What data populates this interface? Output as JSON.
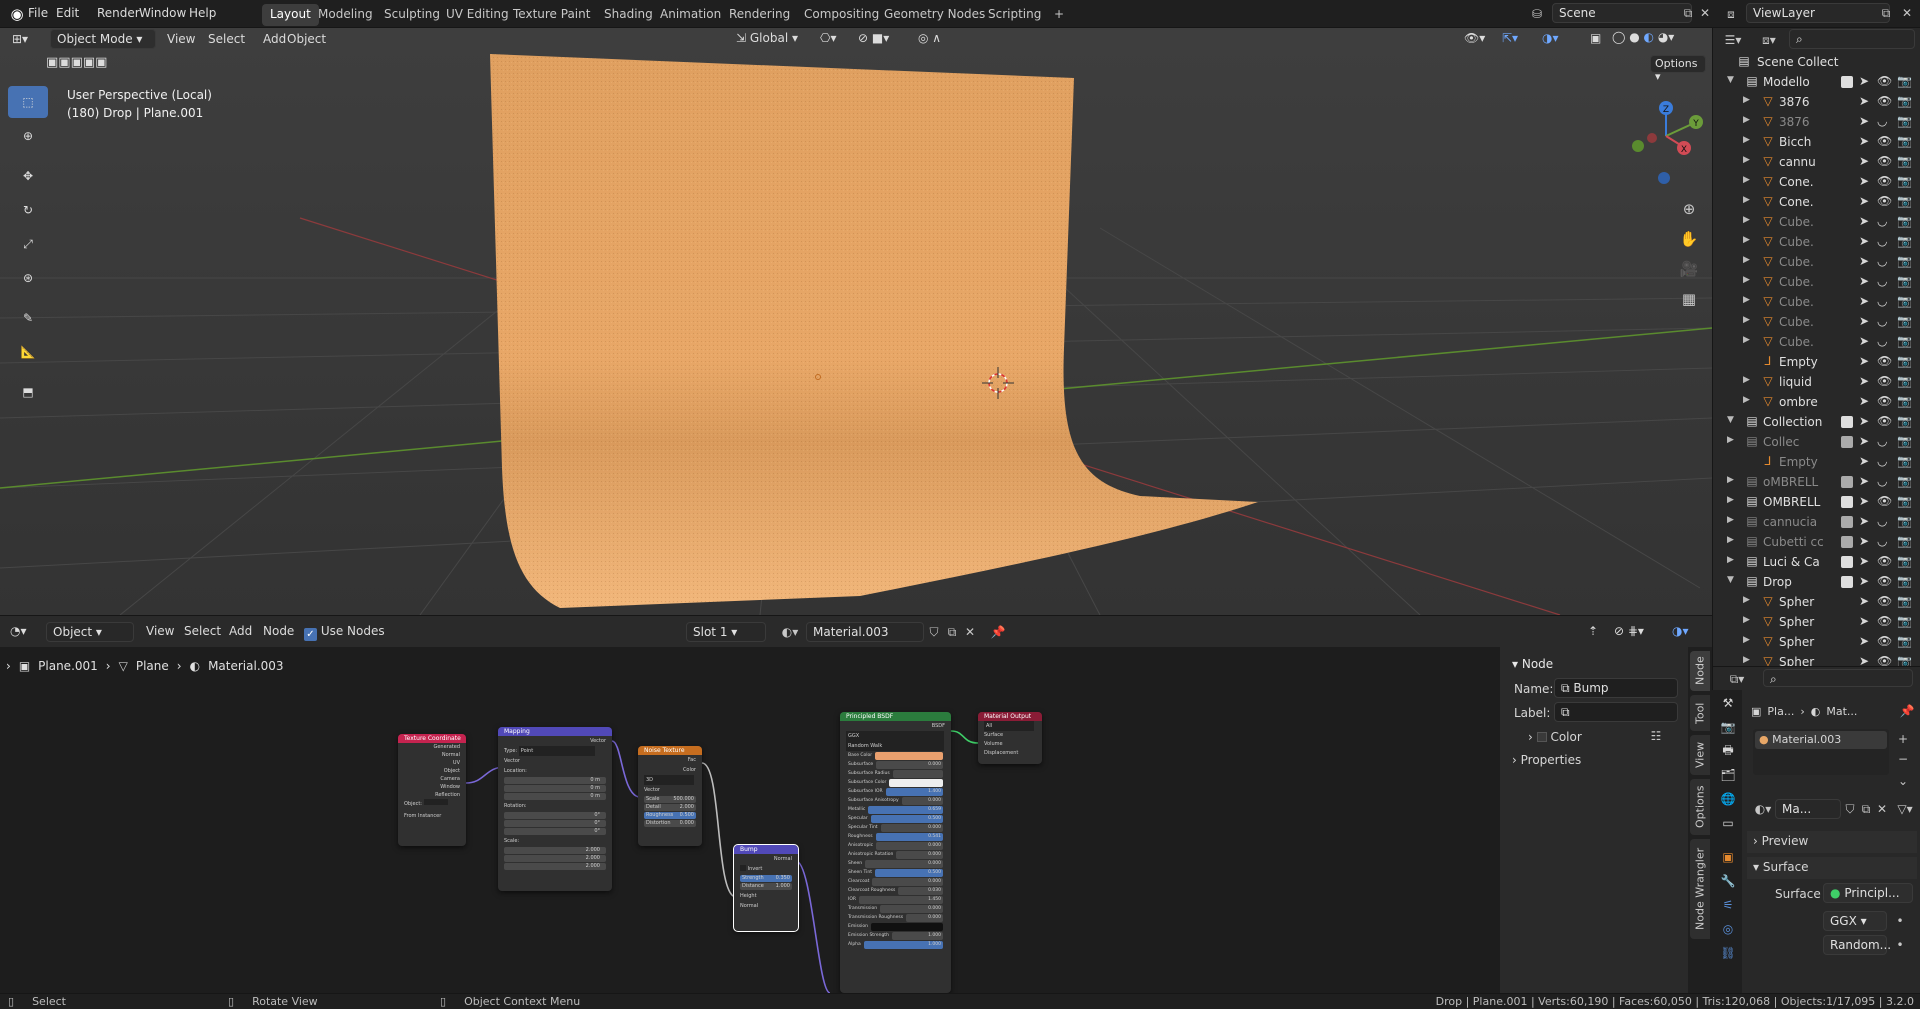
{
  "topbar": {
    "menus": [
      "File",
      "Edit",
      "Render",
      "Window",
      "Help"
    ],
    "workspaces": [
      "Layout",
      "Modeling",
      "Sculpting",
      "UV Editing",
      "Texture Paint",
      "Shading",
      "Animation",
      "Rendering",
      "Compositing",
      "Geometry Nodes",
      "Scripting"
    ],
    "active_workspace": "Layout",
    "add_tab": "+",
    "scene": "Scene",
    "view_layer": "ViewLayer"
  },
  "viewport": {
    "mode": "Object Mode",
    "menus": [
      "View",
      "Select",
      "Add",
      "Object"
    ],
    "orientation": "Global",
    "options": "Options",
    "info_line1": "User Perspective (Local)",
    "info_line2": "(180) Drop | Plane.001",
    "gizmo": {
      "x": "X",
      "y": "Y",
      "z": "Z"
    },
    "colors": {
      "bg": "#3a3a3a",
      "backdrop": "#e7a466",
      "x_axis": "#c0474c",
      "y_axis": "#5a8b2e"
    }
  },
  "tools": [
    "select-box",
    "cursor",
    "move",
    "rotate",
    "scale",
    "transform",
    "annotate",
    "measure",
    "add-cube"
  ],
  "outliner": {
    "title": "Scene Collect",
    "rows": [
      {
        "label": "Modello",
        "type": "collection",
        "depth": 0,
        "expanded": true,
        "checked": true,
        "dim": false
      },
      {
        "label": "3876",
        "type": "mesh",
        "depth": 1,
        "dim": false
      },
      {
        "label": "3876",
        "type": "mesh",
        "depth": 1,
        "dim": true
      },
      {
        "label": "Bicch",
        "type": "mesh",
        "depth": 1,
        "dim": false
      },
      {
        "label": "cannu",
        "type": "mesh",
        "depth": 1,
        "dim": false
      },
      {
        "label": "Cone.",
        "type": "mesh",
        "depth": 1,
        "dim": false
      },
      {
        "label": "Cone.",
        "type": "mesh",
        "depth": 1,
        "dim": false
      },
      {
        "label": "Cube.",
        "type": "mesh",
        "depth": 1,
        "dim": true
      },
      {
        "label": "Cube.",
        "type": "mesh",
        "depth": 1,
        "dim": true
      },
      {
        "label": "Cube.",
        "type": "mesh",
        "depth": 1,
        "dim": true
      },
      {
        "label": "Cube.",
        "type": "mesh",
        "depth": 1,
        "dim": true
      },
      {
        "label": "Cube.",
        "type": "mesh",
        "depth": 1,
        "dim": true
      },
      {
        "label": "Cube.",
        "type": "mesh",
        "depth": 1,
        "dim": true
      },
      {
        "label": "Cube.",
        "type": "mesh",
        "depth": 1,
        "dim": true
      },
      {
        "label": "Empty",
        "type": "empty",
        "depth": 1,
        "dim": false
      },
      {
        "label": "liquid",
        "type": "mesh",
        "depth": 1,
        "dim": false
      },
      {
        "label": "ombre",
        "type": "mesh",
        "depth": 1,
        "dim": false
      },
      {
        "label": "Collection",
        "type": "collection",
        "depth": 0,
        "expanded": true,
        "checked": true,
        "dim": false
      },
      {
        "label": "Collec",
        "type": "collection",
        "depth": 1,
        "checked": true,
        "dim": true
      },
      {
        "label": "Empty",
        "type": "empty",
        "depth": 1,
        "dim": true
      },
      {
        "label": "oMBRELL",
        "type": "collection",
        "depth": 0,
        "checked": true,
        "dim": true
      },
      {
        "label": "OMBRELL",
        "type": "collection",
        "depth": 0,
        "checked": true,
        "dim": false
      },
      {
        "label": "cannucia",
        "type": "collection",
        "depth": 0,
        "checked": true,
        "dim": true
      },
      {
        "label": "Cubetti cc",
        "type": "collection",
        "depth": 0,
        "checked": true,
        "dim": true
      },
      {
        "label": "Luci & Ca",
        "type": "collection",
        "depth": 0,
        "checked": true,
        "dim": false
      },
      {
        "label": "Drop",
        "type": "collection",
        "depth": 0,
        "expanded": true,
        "checked": true,
        "dim": false
      },
      {
        "label": "Spher",
        "type": "mesh",
        "depth": 1,
        "dim": false
      },
      {
        "label": "Spher",
        "type": "mesh",
        "depth": 1,
        "dim": false
      },
      {
        "label": "Spher",
        "type": "mesh",
        "depth": 1,
        "dim": false
      },
      {
        "label": "Spher",
        "type": "mesh",
        "depth": 1,
        "dim": false
      }
    ]
  },
  "node_editor": {
    "editor_type": "Object",
    "menus": [
      "View",
      "Select",
      "Add",
      "Node"
    ],
    "use_nodes_label": "Use Nodes",
    "slot": "Slot 1",
    "material": "Material.003",
    "breadcrumb": [
      "Plane.001",
      "Plane",
      "Material.003"
    ],
    "nodes": {
      "texcoord": {
        "title": "Texture Coordinate",
        "outputs": [
          "Generated",
          "Normal",
          "UV",
          "Object",
          "Camera",
          "Window",
          "Reflection"
        ],
        "object_label": "Object",
        "instancer": "From Instancer"
      },
      "mapping": {
        "title": "Mapping",
        "out": "Vector",
        "type_label": "Type:",
        "type": "Point",
        "vector": "Vector",
        "location": "Location:",
        "rotation": "Rotation:",
        "scale": "Scale:",
        "loc": [
          "0 m",
          "0 m",
          "0 m"
        ],
        "rot": [
          "0°",
          "0°",
          "0°"
        ],
        "scl": [
          "2.000",
          "2.000",
          "2.000"
        ]
      },
      "noise": {
        "title": "Noise Texture",
        "outputs": [
          "Fac",
          "Color"
        ],
        "dim": "3D",
        "vector": "Vector",
        "fields": [
          [
            "Scale",
            "500.000"
          ],
          [
            "Detail",
            "2.000"
          ],
          [
            "Roughness",
            "0.500"
          ],
          [
            "Distortion",
            "0.000"
          ]
        ]
      },
      "bump": {
        "title": "Bump",
        "out": "Normal",
        "invert": "Invert",
        "fields": [
          [
            "Strength",
            "0.350"
          ],
          [
            "Distance",
            "1.000"
          ]
        ],
        "inputs": [
          "Height",
          "Normal"
        ]
      },
      "bsdf": {
        "title": "Principled BSDF",
        "out": "BSDF",
        "dist": "GGX",
        "sss": "Random Walk",
        "rows": [
          [
            "Base Color",
            ""
          ],
          [
            "Subsurface",
            "0.000"
          ],
          [
            "Subsurface Radius",
            ""
          ],
          [
            "Subsurface Color",
            ""
          ],
          [
            "Subsurface IOR",
            "1.400"
          ],
          [
            "Subsurface Anisotropy",
            "0.000"
          ],
          [
            "Metallic",
            "0.659"
          ],
          [
            "Specular",
            "0.500"
          ],
          [
            "Specular Tint",
            "0.000"
          ],
          [
            "Roughness",
            "0.541"
          ],
          [
            "Anisotropic",
            "0.000"
          ],
          [
            "Anisotropic Rotation",
            "0.000"
          ],
          [
            "Sheen",
            "0.000"
          ],
          [
            "Sheen Tint",
            "0.500"
          ],
          [
            "Clearcoat",
            "0.000"
          ],
          [
            "Clearcoat Roughness",
            "0.030"
          ],
          [
            "IOR",
            "1.450"
          ],
          [
            "Transmission",
            "0.000"
          ],
          [
            "Transmission Roughness",
            "0.000"
          ],
          [
            "Emission",
            ""
          ],
          [
            "Emission Strength",
            "1.000"
          ],
          [
            "Alpha",
            "1.000"
          ]
        ]
      },
      "output": {
        "title": "Material Output",
        "target": "All",
        "inputs": [
          "Surface",
          "Volume",
          "Displacement"
        ]
      }
    }
  },
  "n_panel": {
    "section": "Node",
    "name_label": "Name:",
    "name_value": "Bump",
    "label_label": "Label:",
    "label_value": "",
    "color": "Color",
    "properties": "Properties",
    "tabs": [
      "Node",
      "Tool",
      "View",
      "Options",
      "Node Wrangler"
    ]
  },
  "properties": {
    "breadcrumb": [
      "Pla...",
      "Mat..."
    ],
    "slot_material": "Material.003",
    "material_field": "Ma...",
    "preview": "Preview",
    "surface_section": "Surface",
    "surface_label": "Surface",
    "surface_value": "Principl...",
    "dist": "GGX",
    "sss": "Random..."
  },
  "statusbar": {
    "left": [
      [
        "mouse-left",
        "Select"
      ],
      [
        "mouse-middle",
        "Rotate View"
      ],
      [
        "mouse-right",
        "Object Context Menu"
      ]
    ],
    "right": "Drop | Plane.001 | Verts:60,190 | Faces:60,050 | Tris:120,068 | Objects:1/17,095 | 3.2.0"
  }
}
